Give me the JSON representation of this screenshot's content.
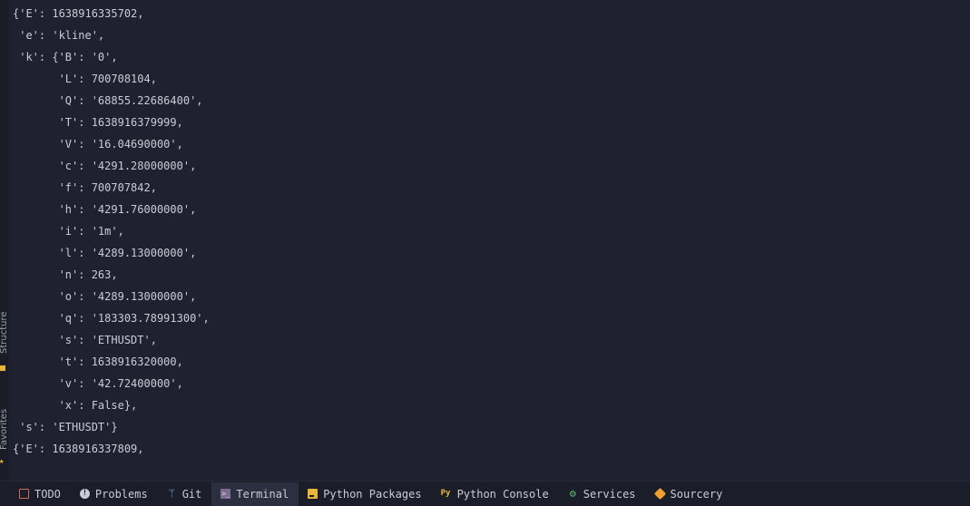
{
  "terminal": {
    "lines": [
      "{'E': 1638916335702,",
      " 'e': 'kline',",
      " 'k': {'B': '0',",
      "       'L': 700708104,",
      "       'Q': '68855.22686400',",
      "       'T': 1638916379999,",
      "       'V': '16.04690000',",
      "       'c': '4291.28000000',",
      "       'f': 700707842,",
      "       'h': '4291.76000000',",
      "       'i': '1m',",
      "       'l': '4289.13000000',",
      "       'n': 263,",
      "       'o': '4289.13000000',",
      "       'q': '183303.78991300',",
      "       's': 'ETHUSDT',",
      "       't': 1638916320000,",
      "       'v': '42.72400000',",
      "       'x': False},",
      " 's': 'ETHUSDT'}",
      "{'E': 1638916337809,"
    ]
  },
  "side_panel": {
    "structure_label": "Structure",
    "favorites_label": "Favorites"
  },
  "bottom_bar": {
    "tabs": [
      {
        "label": "TODO",
        "icon": "todo-icon"
      },
      {
        "label": "Problems",
        "icon": "problems-icon"
      },
      {
        "label": "Git",
        "icon": "git-branch-icon"
      },
      {
        "label": "Terminal",
        "icon": "terminal-icon",
        "active": true
      },
      {
        "label": "Python Packages",
        "icon": "python-packages-icon"
      },
      {
        "label": "Python Console",
        "icon": "python-console-icon"
      },
      {
        "label": "Services",
        "icon": "services-gear-icon"
      },
      {
        "label": "Sourcery",
        "icon": "sourcery-icon"
      }
    ]
  },
  "colors": {
    "background": "#1f2130",
    "text": "#c9ccd6",
    "accent_yellow": "#e8b53a",
    "active_tab": "#2c2f3f"
  }
}
